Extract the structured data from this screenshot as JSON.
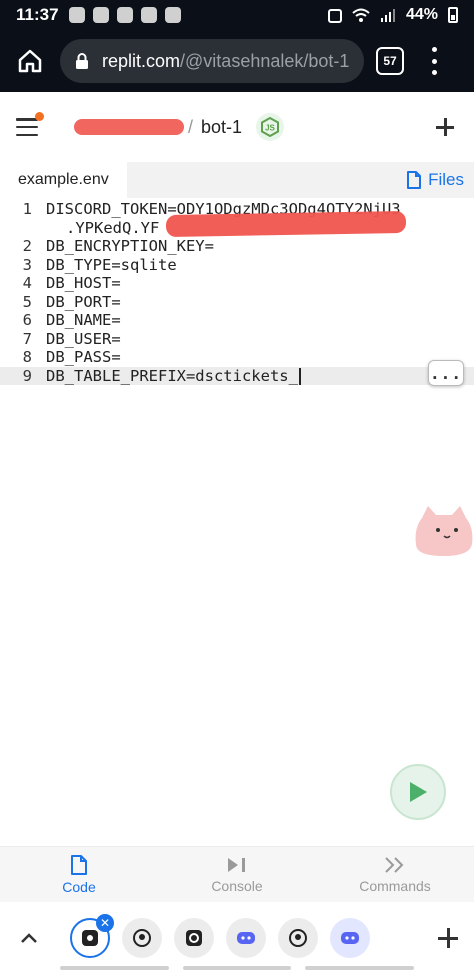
{
  "status": {
    "time": "11:37",
    "battery": "44%"
  },
  "browser": {
    "url_domain": "replit.com",
    "url_path": "/@vitasehnalek/bot-1",
    "tab_count": "57"
  },
  "header": {
    "separator": "/",
    "repl_name": "bot-1"
  },
  "filebar": {
    "file_tab": "example.env",
    "files_label": "Files"
  },
  "editor": {
    "lines": [
      {
        "num": "1",
        "text": "DISCORD_TOKEN=ODY1ODgzMDc3ODg4OTY2NjU3"
      },
      {
        "num": "",
        "text": ".YPKedQ.YF"
      },
      {
        "num": "2",
        "text": "DB_ENCRYPTION_KEY="
      },
      {
        "num": "3",
        "text": "DB_TYPE=sqlite"
      },
      {
        "num": "4",
        "text": "DB_HOST="
      },
      {
        "num": "5",
        "text": "DB_PORT="
      },
      {
        "num": "6",
        "text": "DB_NAME="
      },
      {
        "num": "7",
        "text": "DB_USER="
      },
      {
        "num": "8",
        "text": "DB_PASS="
      },
      {
        "num": "9",
        "text": "DB_TABLE_PREFIX=dsctickets_"
      }
    ],
    "more_label": "..."
  },
  "nav": {
    "code": "Code",
    "console": "Console",
    "commands": "Commands"
  },
  "colors": {
    "accent": "#1a73e8",
    "redaction": "#f0554e",
    "run_green": "#4caf6a",
    "notif": "#f36f21"
  }
}
